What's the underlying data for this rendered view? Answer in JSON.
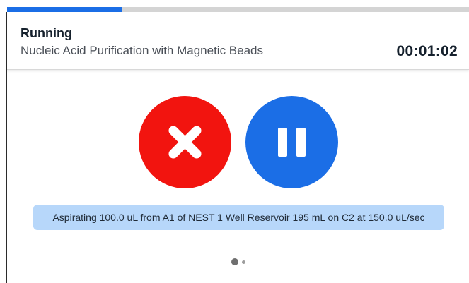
{
  "status": {
    "label": "Running"
  },
  "protocol": {
    "name": "Nucleic Acid Purification with Magnetic Beads"
  },
  "timer": {
    "elapsed": "00:01:02"
  },
  "progress": {
    "fraction": 0.25,
    "color": "#1b6ee6"
  },
  "controls": {
    "cancel": {
      "icon": "close-icon",
      "color": "#f2140f"
    },
    "pause": {
      "icon": "pause-icon",
      "color": "#1b6ee6"
    }
  },
  "command": {
    "text": "Aspirating 100.0 uL from A1 of NEST 1 Well Reservoir 195 mL on C2 at 150.0 uL/sec",
    "background": "#b7d7fa"
  },
  "pagination": {
    "current": 1,
    "total": 2
  }
}
